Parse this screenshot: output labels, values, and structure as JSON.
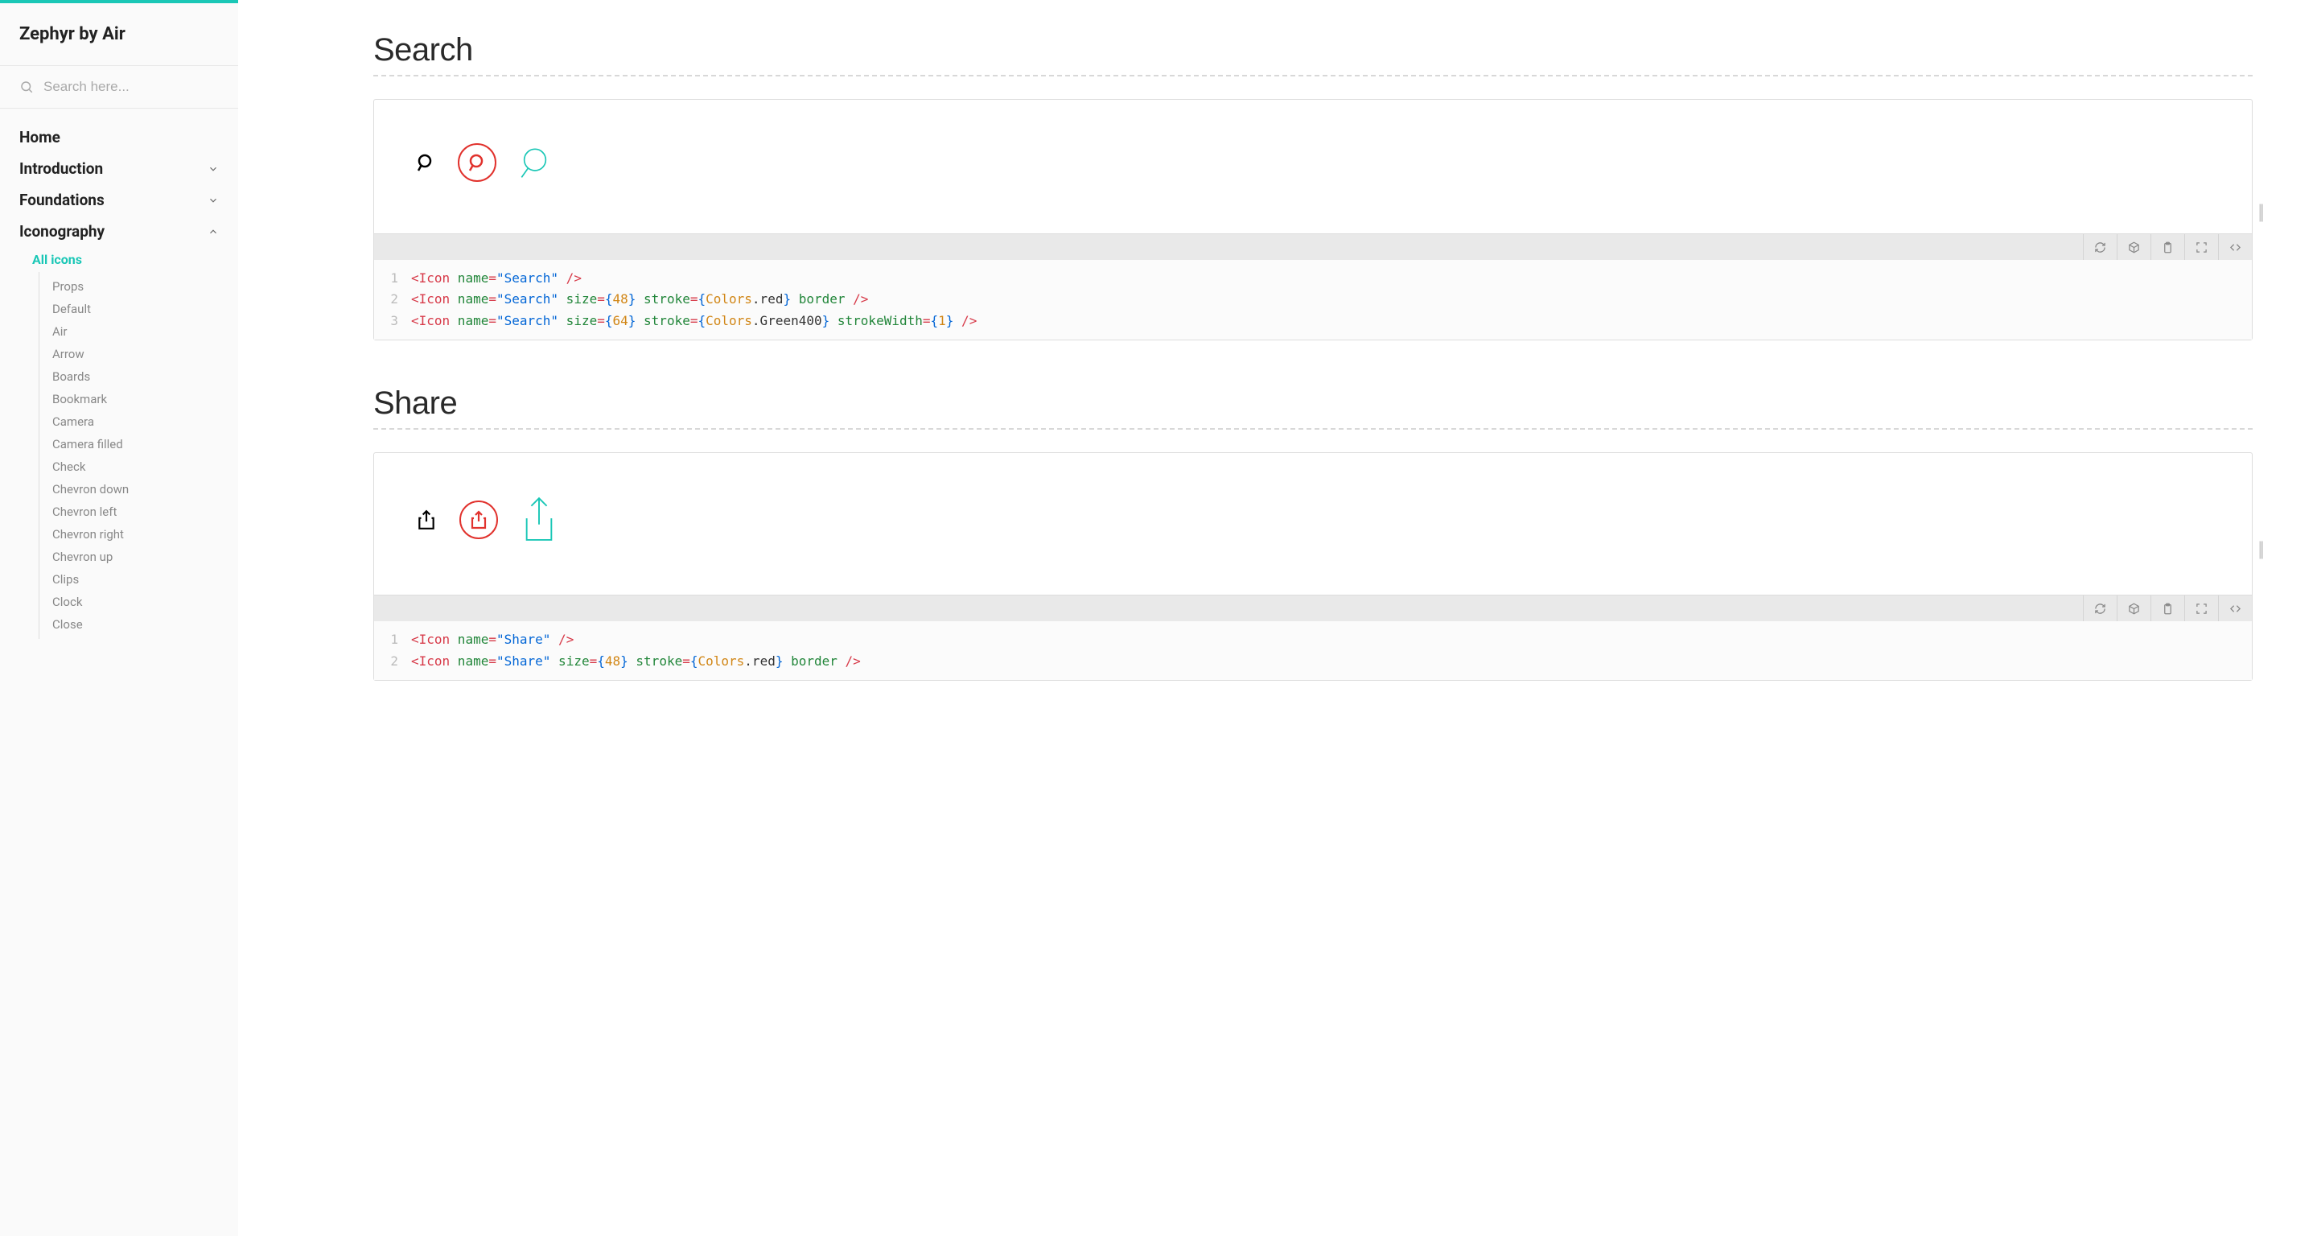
{
  "brand": "Zephyr by Air",
  "search_placeholder": "Search here...",
  "nav": {
    "home": "Home",
    "introduction": "Introduction",
    "foundations": "Foundations",
    "iconography": "Iconography",
    "all_icons": "All icons",
    "leaves": [
      "Props",
      "Default",
      "Air",
      "Arrow",
      "Boards",
      "Bookmark",
      "Camera",
      "Camera filled",
      "Check",
      "Chevron down",
      "Chevron left",
      "Chevron right",
      "Chevron up",
      "Clips",
      "Clock",
      "Close"
    ]
  },
  "sections": {
    "search": {
      "title": "Search"
    },
    "share": {
      "title": "Share"
    }
  },
  "code": {
    "search": [
      [
        [
          "p-red",
          "<Icon"
        ],
        [
          "p-green",
          " name"
        ],
        [
          "p-red",
          "="
        ],
        [
          "p-blue",
          "\"Search\""
        ],
        [
          "p-red",
          " />"
        ]
      ],
      [
        [
          "p-red",
          "<Icon"
        ],
        [
          "p-green",
          " name"
        ],
        [
          "p-red",
          "="
        ],
        [
          "p-blue",
          "\"Search\""
        ],
        [
          "p-green",
          " size"
        ],
        [
          "p-red",
          "="
        ],
        [
          "p-blue",
          "{"
        ],
        [
          "p-orange",
          "48"
        ],
        [
          "p-blue",
          "}"
        ],
        [
          "p-green",
          " stroke"
        ],
        [
          "p-red",
          "="
        ],
        [
          "p-blue",
          "{"
        ],
        [
          "p-orange",
          "Colors"
        ],
        [
          "p-black",
          ".red"
        ],
        [
          "p-blue",
          "}"
        ],
        [
          "p-green",
          " border"
        ],
        [
          "p-red",
          " />"
        ]
      ],
      [
        [
          "p-red",
          "<Icon"
        ],
        [
          "p-green",
          " name"
        ],
        [
          "p-red",
          "="
        ],
        [
          "p-blue",
          "\"Search\""
        ],
        [
          "p-green",
          " size"
        ],
        [
          "p-red",
          "="
        ],
        [
          "p-blue",
          "{"
        ],
        [
          "p-orange",
          "64"
        ],
        [
          "p-blue",
          "}"
        ],
        [
          "p-green",
          " stroke"
        ],
        [
          "p-red",
          "="
        ],
        [
          "p-blue",
          "{"
        ],
        [
          "p-orange",
          "Colors"
        ],
        [
          "p-black",
          ".Green400"
        ],
        [
          "p-blue",
          "}"
        ],
        [
          "p-green",
          " strokeWidth"
        ],
        [
          "p-red",
          "="
        ],
        [
          "p-blue",
          "{"
        ],
        [
          "p-orange",
          "1"
        ],
        [
          "p-blue",
          "}"
        ],
        [
          "p-red",
          " />"
        ]
      ]
    ],
    "share": [
      [
        [
          "p-red",
          "<Icon"
        ],
        [
          "p-green",
          " name"
        ],
        [
          "p-red",
          "="
        ],
        [
          "p-blue",
          "\"Share\""
        ],
        [
          "p-red",
          " />"
        ]
      ],
      [
        [
          "p-red",
          "<Icon"
        ],
        [
          "p-green",
          " name"
        ],
        [
          "p-red",
          "="
        ],
        [
          "p-blue",
          "\"Share\""
        ],
        [
          "p-green",
          " size"
        ],
        [
          "p-red",
          "="
        ],
        [
          "p-blue",
          "{"
        ],
        [
          "p-orange",
          "48"
        ],
        [
          "p-blue",
          "}"
        ],
        [
          "p-green",
          " stroke"
        ],
        [
          "p-red",
          "="
        ],
        [
          "p-blue",
          "{"
        ],
        [
          "p-orange",
          "Colors"
        ],
        [
          "p-black",
          ".red"
        ],
        [
          "p-blue",
          "}"
        ],
        [
          "p-green",
          " border"
        ],
        [
          "p-red",
          " />"
        ]
      ]
    ]
  }
}
